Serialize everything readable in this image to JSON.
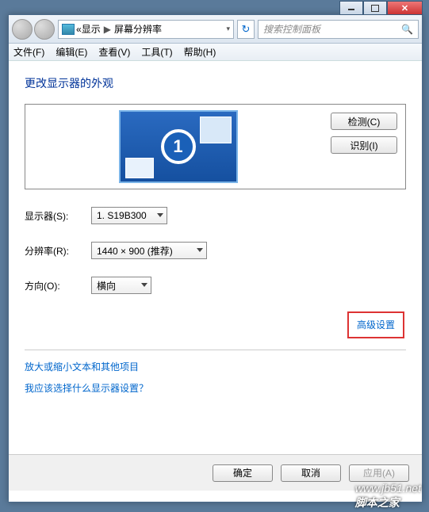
{
  "titlebar": {
    "min": "",
    "max": "",
    "close": ""
  },
  "nav": {
    "crumb_back": "«",
    "crumb1": "显示",
    "crumb_sep": "▶",
    "crumb2": "屏幕分辨率",
    "dd": "▾",
    "refresh": "↻",
    "search_placeholder": "搜索控制面板",
    "search_icon": "🔍"
  },
  "menu": {
    "file": "文件(F)",
    "edit": "编辑(E)",
    "view": "查看(V)",
    "tools": "工具(T)",
    "help": "帮助(H)"
  },
  "page": {
    "heading": "更改显示器的外观",
    "monitor_num": "1",
    "detect": "检测(C)",
    "identify": "识别(I)",
    "display_label": "显示器(S):",
    "display_value": "1. S19B300",
    "resolution_label": "分辨率(R):",
    "resolution_value": "1440 × 900 (推荐)",
    "orientation_label": "方向(O):",
    "orientation_value": "横向",
    "advanced": "高级设置",
    "link_text": "放大或缩小文本和其他项目",
    "link_which": "我应该选择什么显示器设置？",
    "ok": "确定",
    "cancel": "取消",
    "apply": "应用(A)"
  },
  "watermark": {
    "url": "www.jb51.net",
    "name": "脚本之家"
  }
}
